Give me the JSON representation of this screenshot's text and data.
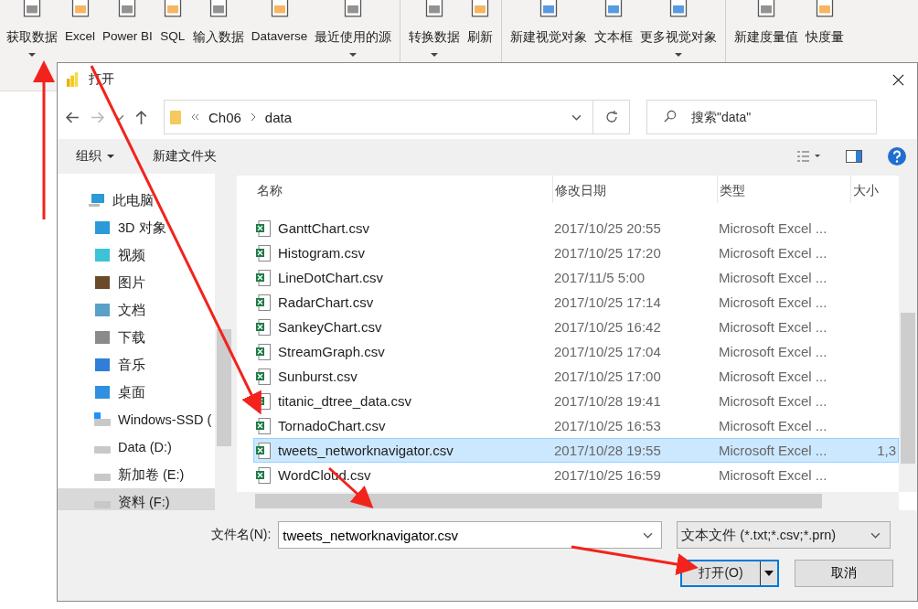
{
  "ribbon": {
    "groups": [
      {
        "items": [
          {
            "label": "获取数据",
            "dropdown": true
          },
          {
            "label": "Excel",
            "dropdown": false
          },
          {
            "label": "Power BI",
            "dropdown": false
          },
          {
            "label": "SQL",
            "dropdown": false
          },
          {
            "label": "输入数据",
            "dropdown": false
          },
          {
            "label": "Dataverse",
            "dropdown": false
          },
          {
            "label": "最近使用的源",
            "dropdown": true
          }
        ]
      },
      {
        "items": [
          {
            "label": "转换数据",
            "dropdown": true
          },
          {
            "label": "刷新",
            "dropdown": false
          }
        ]
      },
      {
        "items": [
          {
            "label": "新建视觉对象",
            "dropdown": false
          },
          {
            "label": "文本框",
            "dropdown": false
          },
          {
            "label": "更多视觉对象",
            "dropdown": true
          }
        ]
      },
      {
        "items": [
          {
            "label": "新建度量值",
            "dropdown": false
          },
          {
            "label": "快度量",
            "dropdown": false
          }
        ]
      }
    ]
  },
  "dialog": {
    "title": "打开",
    "path": [
      "Ch06",
      "data"
    ],
    "search": {
      "placeholder": "搜索\"data\""
    },
    "toolbar": [
      {
        "label": "组织",
        "dropdown": true
      },
      {
        "label": "新建文件夹",
        "dropdown": false
      }
    ],
    "nav": [
      {
        "label": "此电脑",
        "selected": false,
        "children": [
          {
            "label": "3D 对象",
            "selected": false
          },
          {
            "label": "视频",
            "selected": false
          },
          {
            "label": "图片",
            "selected": false
          },
          {
            "label": "文档",
            "selected": false
          },
          {
            "label": "下载",
            "selected": false
          },
          {
            "label": "音乐",
            "selected": false
          },
          {
            "label": "桌面",
            "selected": false
          },
          {
            "label": "Windows-SSD (",
            "selected": false
          },
          {
            "label": "Data (D:)",
            "selected": false
          },
          {
            "label": "新加卷 (E:)",
            "selected": false
          },
          {
            "label": "资料 (F:)",
            "selected": true
          }
        ]
      }
    ],
    "columns": [
      "名称",
      "修改日期",
      "类型",
      "大小"
    ],
    "rows": [
      {
        "name": "GanttChart.csv",
        "date": "2017/10/25 20:55",
        "type": "Microsoft Excel ...",
        "selected": false
      },
      {
        "name": "Histogram.csv",
        "date": "2017/10/25 17:20",
        "type": "Microsoft Excel ...",
        "selected": false
      },
      {
        "name": "LineDotChart.csv",
        "date": "2017/11/5 5:00",
        "type": "Microsoft Excel ...",
        "selected": false
      },
      {
        "name": "RadarChart.csv",
        "date": "2017/10/25 17:14",
        "type": "Microsoft Excel ...",
        "selected": false
      },
      {
        "name": "SankeyChart.csv",
        "date": "2017/10/25 16:42",
        "type": "Microsoft Excel ...",
        "selected": false
      },
      {
        "name": "StreamGraph.csv",
        "date": "2017/10/25 17:04",
        "type": "Microsoft Excel ...",
        "selected": false
      },
      {
        "name": "Sunburst.csv",
        "date": "2017/10/25 17:00",
        "type": "Microsoft Excel ...",
        "selected": false
      },
      {
        "name": "titanic_dtree_data.csv",
        "date": "2017/10/28 19:41",
        "type": "Microsoft Excel ...",
        "selected": false
      },
      {
        "name": "TornadoChart.csv",
        "date": "2017/10/25 16:53",
        "type": "Microsoft Excel ...",
        "selected": false
      },
      {
        "name": "tweets_networknavigator.csv",
        "date": "2017/10/28 19:55",
        "type": "Microsoft Excel ...",
        "size": "1,3",
        "selected": true
      },
      {
        "name": "WordCloud.csv",
        "date": "2017/10/25 16:59",
        "type": "Microsoft Excel ...",
        "selected": false
      }
    ],
    "filename_label": "文件名(N):",
    "filename": "tweets_networknavigator.csv",
    "filetype": "文本文件 (*.txt;*.csv;*.prn)",
    "buttons": [
      {
        "label": "打开(O)",
        "kind": "primary"
      },
      {
        "label": "取消",
        "kind": "normal"
      }
    ]
  }
}
